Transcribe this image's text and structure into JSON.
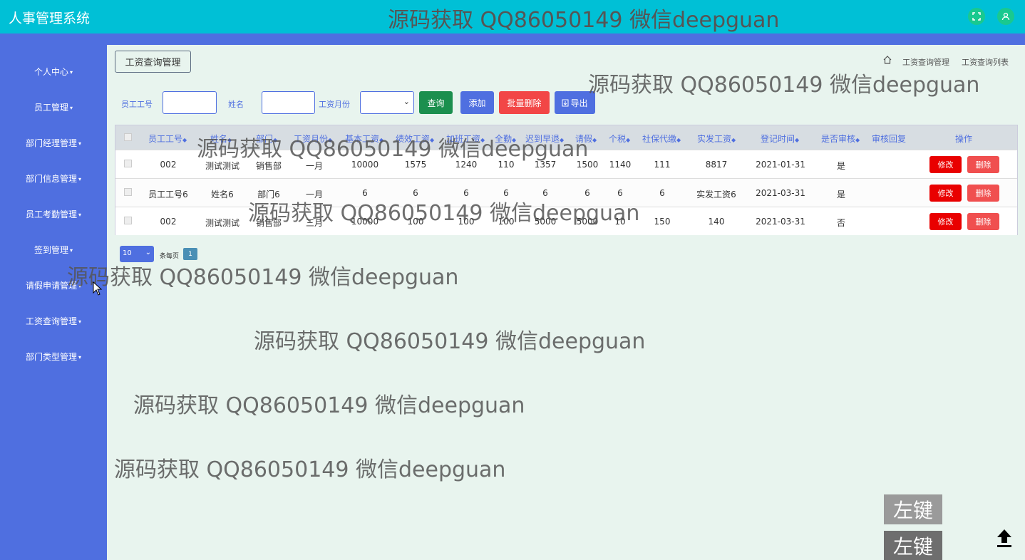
{
  "header": {
    "app_title": "人事管理系统",
    "watermark": "源码获取 QQ86050149 微信deepguan"
  },
  "sidebar": {
    "items": [
      {
        "label": "个人中心"
      },
      {
        "label": "员工管理"
      },
      {
        "label": "部门经理管理"
      },
      {
        "label": "部门信息管理"
      },
      {
        "label": "员工考勤管理"
      },
      {
        "label": "签到管理"
      },
      {
        "label": "请假申请管理"
      },
      {
        "label": "工资查询管理"
      },
      {
        "label": "部门类型管理"
      }
    ]
  },
  "page": {
    "tag": "工资查询管理",
    "breadcrumb": [
      "工资查询管理",
      "工资查询列表"
    ]
  },
  "filters": {
    "employee_no_label": "员工工号",
    "employee_no_value": "",
    "name_label": "姓名",
    "name_value": "",
    "month_label": "工资月份",
    "month_value": ""
  },
  "buttons": {
    "search": "查询",
    "add": "添加",
    "batch_delete": "批量删除",
    "export": "导出"
  },
  "table": {
    "headers": [
      "员工工号",
      "姓名",
      "部门",
      "工资月份",
      "基本工资",
      "绩效工资",
      "加班工资",
      "全勤",
      "迟到早退",
      "请假",
      "个税",
      "社保代缴",
      "实发工资",
      "登记时间",
      "是否审核",
      "审核回复",
      "操作"
    ],
    "rows": [
      [
        "002",
        "测试测试",
        "销售部",
        "一月",
        "10000",
        "1575",
        "1240",
        "110",
        "1357",
        "1500",
        "1140",
        "111",
        "8817",
        "2021-01-31",
        "是",
        ""
      ],
      [
        "员工工号6",
        "姓名6",
        "部门6",
        "一月",
        "6",
        "6",
        "6",
        "6",
        "6",
        "6",
        "6",
        "6",
        "实发工资6",
        "2021-03-31",
        "是",
        ""
      ],
      [
        "002",
        "测试测试",
        "销售部",
        "三月",
        "10000",
        "100",
        "100",
        "100",
        "5000",
        "5000",
        "10",
        "150",
        "140",
        "2021-03-31",
        "否",
        ""
      ]
    ],
    "edit_label": "修改",
    "delete_label": "删除"
  },
  "pagination": {
    "page_size": "10",
    "per_page_label": "条每页",
    "current_page": "1"
  },
  "overlay": {
    "left_click_1": "左键",
    "left_click_2": "左键"
  },
  "colors": {
    "topbar": "#00c0d6",
    "sidebar": "#4f6fe0",
    "content_bg": "#e8f4ee",
    "danger": "#e90000",
    "success": "#1b8f4e"
  }
}
